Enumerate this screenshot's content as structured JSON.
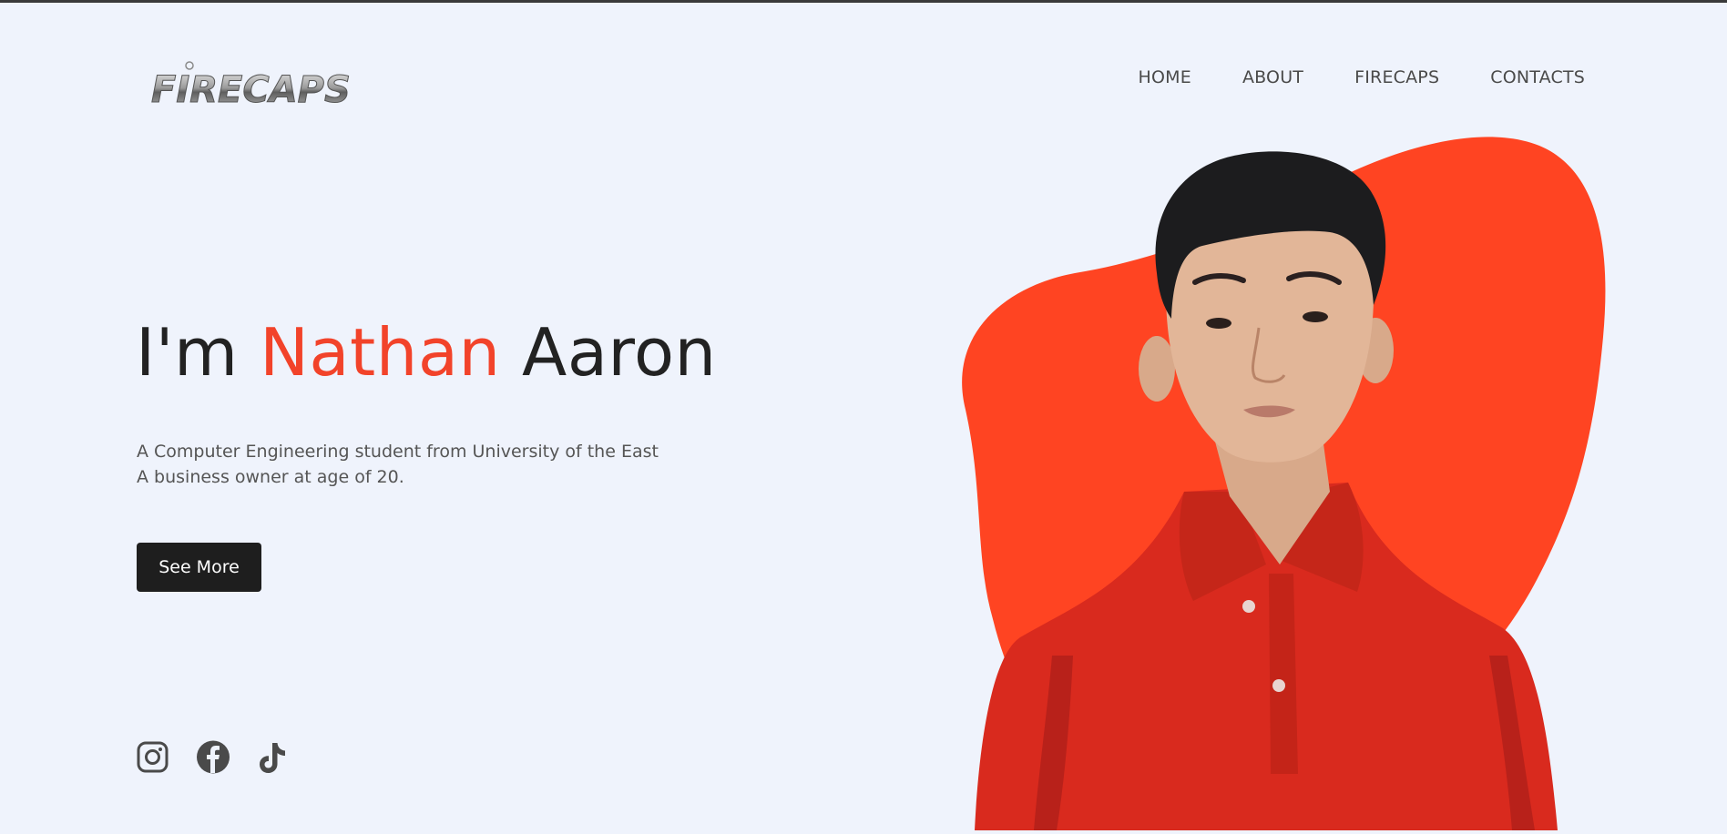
{
  "logo": {
    "text": "FIRECAPS"
  },
  "nav": {
    "items": [
      {
        "label": "HOME"
      },
      {
        "label": "ABOUT"
      },
      {
        "label": "FIRECAPS"
      },
      {
        "label": "CONTACTS"
      }
    ]
  },
  "hero": {
    "title_prefix": "I'm ",
    "title_accent": "Nathan",
    "title_suffix": " Aaron",
    "description_line1": "A Computer Engineering student from University of the East",
    "description_line2": "A business owner at age of 20.",
    "button_label": "See More"
  },
  "social": {
    "icons": [
      "instagram-icon",
      "facebook-icon",
      "tiktok-icon"
    ]
  },
  "colors": {
    "accent": "#f2432a",
    "blob": "#ff4422",
    "shirt": "#d92a1e",
    "text_dark": "#222222",
    "text_muted": "#555555",
    "background": "#eff3fc",
    "button_bg": "#1e1e1e"
  }
}
